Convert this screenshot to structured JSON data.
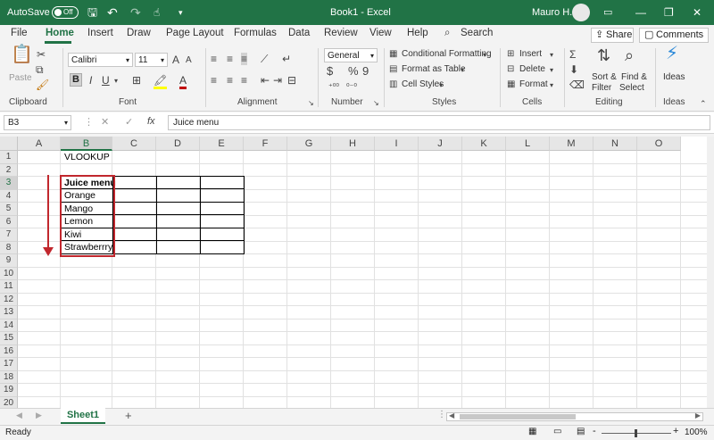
{
  "titlebar": {
    "autosave_label": "AutoSave",
    "autosave_state": "Off",
    "document_title": "Book1 - Excel",
    "user_name": "Mauro H.",
    "minimize": "—",
    "restore": "❐",
    "close": "✕"
  },
  "menu": {
    "tabs": [
      "File",
      "Home",
      "Insert",
      "Draw",
      "Page Layout",
      "Formulas",
      "Data",
      "Review",
      "View",
      "Help"
    ],
    "search_label": "Search",
    "share_label": "Share",
    "comments_label": "Comments"
  },
  "ribbon": {
    "clipboard": {
      "paste_label": "Paste",
      "group_label": "Clipboard"
    },
    "font": {
      "font_name": "Calibri",
      "font_size": "11",
      "bold": "B",
      "italic": "I",
      "underline": "U",
      "group_label": "Font"
    },
    "alignment": {
      "group_label": "Alignment"
    },
    "number": {
      "format": "General",
      "currency": "$",
      "percent": "%",
      "comma": "9",
      "group_label": "Number"
    },
    "styles": {
      "conditional": "Conditional Formatting",
      "format_table": "Format as Table",
      "cell_styles": "Cell Styles",
      "group_label": "Styles"
    },
    "cells": {
      "insert": "Insert",
      "delete": "Delete",
      "format": "Format",
      "group_label": "Cells"
    },
    "editing": {
      "sort_filter_1": "Sort &",
      "sort_filter_2": "Filter",
      "find_select_1": "Find &",
      "find_select_2": "Select",
      "group_label": "Editing"
    },
    "ideas": {
      "label": "Ideas",
      "group_label": "Ideas"
    }
  },
  "formula_bar": {
    "name_box": "B3",
    "cancel": "✕",
    "enter": "✓",
    "fx": "fx",
    "content": "Juice menu"
  },
  "grid": {
    "columns": [
      "A",
      "B",
      "C",
      "D",
      "E",
      "F",
      "G",
      "H",
      "I",
      "J",
      "K",
      "L",
      "M",
      "N",
      "O"
    ],
    "selected_column": "B",
    "selected_row": "3",
    "rows": [
      "1",
      "2",
      "3",
      "4",
      "5",
      "6",
      "7",
      "8",
      "9",
      "10",
      "11",
      "12",
      "13",
      "14",
      "15",
      "16",
      "17",
      "18",
      "19",
      "20"
    ],
    "cells": {
      "B1": "VLOOKUP",
      "B3": "Juice menu",
      "B4": "Orange",
      "B5": "Mango",
      "B6": "Lemon",
      "B7": "Kiwi",
      "B8": "Strawberrry"
    }
  },
  "sheets": {
    "active": "Sheet1",
    "add": "+"
  },
  "status": {
    "ready": "Ready",
    "zoom": "100%",
    "zoom_minus": "-",
    "zoom_plus": "+"
  },
  "colors": {
    "accent": "#217346",
    "highlight": "#c1272d"
  }
}
